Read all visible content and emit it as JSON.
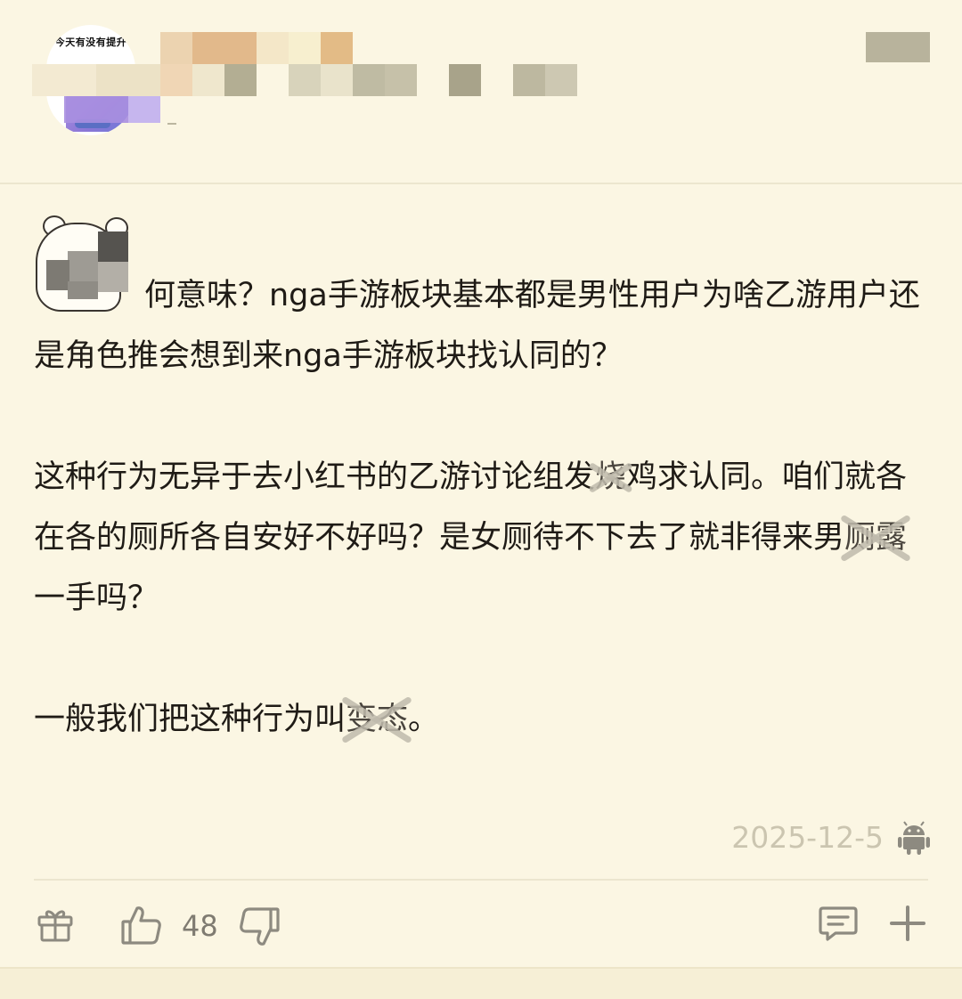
{
  "header": {
    "avatar_caption": "今天有没有提升",
    "username_mosaic_colors": [
      "#e2b98b",
      "#f0d6b5",
      "#f7efcf",
      "#e3bb86",
      "#c9c4ab",
      "#b3ae93",
      "#d8d3bb",
      "#bfbba3",
      "#a8a38a",
      "#bdb8a0",
      "#cdc8b2"
    ],
    "accent_color": "#b8b39c"
  },
  "post": {
    "paragraph_1_a": "何意味？nga手游板块基本都是男性用户为啥乙游用户还是角色推会想到来nga手游板块找认同的？",
    "paragraph_2_a": "这种行为无异于去小红书的乙游讨论组发",
    "paragraph_2_censor_1": "烧",
    "paragraph_2_b": "鸡求认同。咱们就各在各的厕所各自安好不好吗？是女厕待不下去了就非得来男",
    "paragraph_2_censor_2": "厕露",
    "paragraph_2_c": "一手吗？",
    "paragraph_3_a": "一般我们把这种行为叫",
    "paragraph_3_censor": "变态",
    "paragraph_3_b": "。",
    "timestamp": "2025-12-5",
    "platform_icon": "android-icon"
  },
  "actions": {
    "gift_icon": "gift-icon",
    "like_icon": "thumbs-up-icon",
    "like_count": "48",
    "dislike_icon": "thumbs-down-icon",
    "comment_icon": "comment-icon",
    "more_icon": "plus-icon"
  }
}
